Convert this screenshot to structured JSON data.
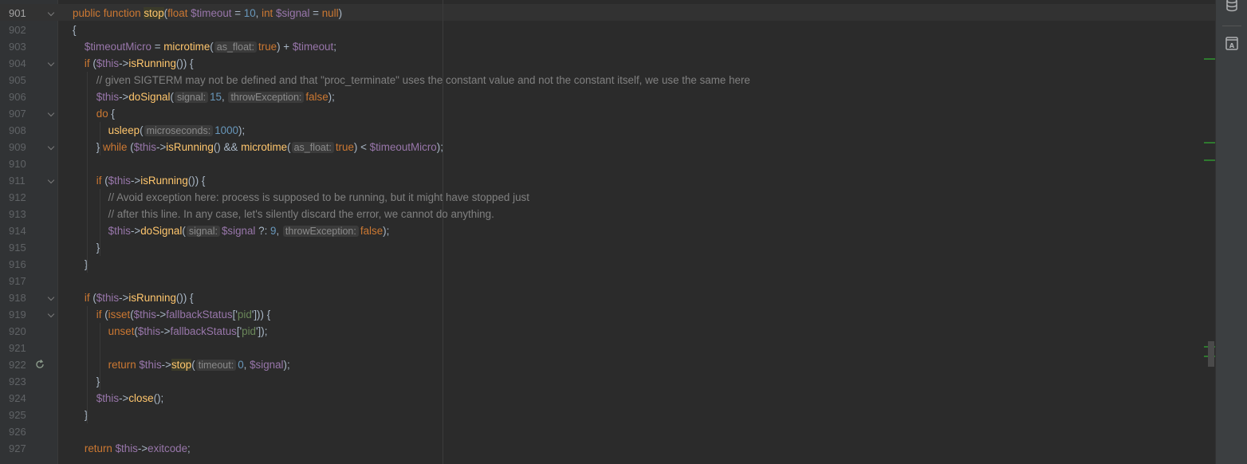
{
  "editor": {
    "lines": [
      {
        "n": "901",
        "fold": true,
        "current": true,
        "segs": [
          [
            "kw",
            "public function "
          ],
          [
            "fn-hl",
            "stop"
          ],
          [
            "plain",
            "("
          ],
          [
            "kw",
            "float "
          ],
          [
            "var",
            "$timeout"
          ],
          [
            "plain",
            " = "
          ],
          [
            "num",
            "10"
          ],
          [
            "plain",
            ", "
          ],
          [
            "kw",
            "int "
          ],
          [
            "var",
            "$signal"
          ],
          [
            "plain",
            " = "
          ],
          [
            "kw",
            "null"
          ],
          [
            "plain",
            ")"
          ]
        ]
      },
      {
        "n": "902",
        "segs": [
          [
            "plain",
            "{"
          ]
        ]
      },
      {
        "n": "903",
        "segs": [
          [
            "plain",
            "    "
          ],
          [
            "var",
            "$timeoutMicro"
          ],
          [
            "plain",
            " = "
          ],
          [
            "fn",
            "microtime"
          ],
          [
            "plain",
            "("
          ],
          [
            "hint",
            "as_float:"
          ],
          [
            "kw",
            "true"
          ],
          [
            "plain",
            ") + "
          ],
          [
            "var",
            "$timeout"
          ],
          [
            "plain",
            ";"
          ]
        ]
      },
      {
        "n": "904",
        "fold": true,
        "segs": [
          [
            "plain",
            "    "
          ],
          [
            "kw",
            "if "
          ],
          [
            "plain",
            "("
          ],
          [
            "var",
            "$this"
          ],
          [
            "plain",
            "->"
          ],
          [
            "fn",
            "isRunning"
          ],
          [
            "plain",
            "()) {"
          ]
        ]
      },
      {
        "n": "905",
        "segs": [
          [
            "plain",
            "        "
          ],
          [
            "cmt",
            "// given SIGTERM may not be defined and that \"proc_terminate\" uses the constant value and not the constant itself, we use the same here"
          ]
        ]
      },
      {
        "n": "906",
        "segs": [
          [
            "plain",
            "        "
          ],
          [
            "var",
            "$this"
          ],
          [
            "plain",
            "->"
          ],
          [
            "fn",
            "doSignal"
          ],
          [
            "plain",
            "("
          ],
          [
            "hint",
            "signal:"
          ],
          [
            "num",
            "15"
          ],
          [
            "plain",
            ", "
          ],
          [
            "hint",
            "throwException:"
          ],
          [
            "kw",
            "false"
          ],
          [
            "plain",
            ");"
          ]
        ]
      },
      {
        "n": "907",
        "fold": true,
        "segs": [
          [
            "plain",
            "        "
          ],
          [
            "kw",
            "do "
          ],
          [
            "plain",
            "{"
          ]
        ]
      },
      {
        "n": "908",
        "segs": [
          [
            "plain",
            "            "
          ],
          [
            "fn",
            "usleep"
          ],
          [
            "plain",
            "("
          ],
          [
            "hint",
            "microseconds:"
          ],
          [
            "num",
            "1000"
          ],
          [
            "plain",
            ");"
          ]
        ]
      },
      {
        "n": "909",
        "fold": true,
        "segs": [
          [
            "plain",
            "        } "
          ],
          [
            "kw",
            "while "
          ],
          [
            "plain",
            "("
          ],
          [
            "var",
            "$this"
          ],
          [
            "plain",
            "->"
          ],
          [
            "fn",
            "isRunning"
          ],
          [
            "plain",
            "() && "
          ],
          [
            "fn",
            "microtime"
          ],
          [
            "plain",
            "("
          ],
          [
            "hint",
            "as_float:"
          ],
          [
            "kw",
            "true"
          ],
          [
            "plain",
            ") < "
          ],
          [
            "var",
            "$timeoutMicro"
          ],
          [
            "plain",
            ");"
          ]
        ]
      },
      {
        "n": "910",
        "segs": []
      },
      {
        "n": "911",
        "fold": true,
        "segs": [
          [
            "plain",
            "        "
          ],
          [
            "kw",
            "if "
          ],
          [
            "plain",
            "("
          ],
          [
            "var",
            "$this"
          ],
          [
            "plain",
            "->"
          ],
          [
            "fn",
            "isRunning"
          ],
          [
            "plain",
            "()) {"
          ]
        ]
      },
      {
        "n": "912",
        "segs": [
          [
            "plain",
            "            "
          ],
          [
            "cmt",
            "// Avoid exception here: process is supposed to be running, but it might have stopped just"
          ]
        ]
      },
      {
        "n": "913",
        "segs": [
          [
            "plain",
            "            "
          ],
          [
            "cmt",
            "// after this line. In any case, let's silently discard the error, we cannot do anything."
          ]
        ]
      },
      {
        "n": "914",
        "segs": [
          [
            "plain",
            "            "
          ],
          [
            "var",
            "$this"
          ],
          [
            "plain",
            "->"
          ],
          [
            "fn",
            "doSignal"
          ],
          [
            "plain",
            "("
          ],
          [
            "hint",
            "signal:"
          ],
          [
            "var",
            "$signal"
          ],
          [
            "plain",
            " ?: "
          ],
          [
            "num",
            "9"
          ],
          [
            "plain",
            ", "
          ],
          [
            "hint",
            "throwException:"
          ],
          [
            "kw",
            "false"
          ],
          [
            "plain",
            ");"
          ]
        ]
      },
      {
        "n": "915",
        "segs": [
          [
            "plain",
            "        }"
          ]
        ]
      },
      {
        "n": "916",
        "segs": [
          [
            "plain",
            "    }"
          ]
        ]
      },
      {
        "n": "917",
        "segs": []
      },
      {
        "n": "918",
        "fold": true,
        "segs": [
          [
            "plain",
            "    "
          ],
          [
            "kw",
            "if "
          ],
          [
            "plain",
            "("
          ],
          [
            "var",
            "$this"
          ],
          [
            "plain",
            "->"
          ],
          [
            "fn",
            "isRunning"
          ],
          [
            "plain",
            "()) {"
          ]
        ]
      },
      {
        "n": "919",
        "fold": true,
        "segs": [
          [
            "plain",
            "        "
          ],
          [
            "kw",
            "if "
          ],
          [
            "plain",
            "("
          ],
          [
            "kw",
            "isset"
          ],
          [
            "plain",
            "("
          ],
          [
            "var",
            "$this"
          ],
          [
            "plain",
            "->"
          ],
          [
            "var",
            "fallbackStatus"
          ],
          [
            "plain",
            "['"
          ],
          [
            "str",
            "pid"
          ],
          [
            "plain",
            "'])) {"
          ]
        ]
      },
      {
        "n": "920",
        "segs": [
          [
            "plain",
            "            "
          ],
          [
            "kw",
            "unset"
          ],
          [
            "plain",
            "("
          ],
          [
            "var",
            "$this"
          ],
          [
            "plain",
            "->"
          ],
          [
            "var",
            "fallbackStatus"
          ],
          [
            "plain",
            "['"
          ],
          [
            "str",
            "pid"
          ],
          [
            "plain",
            "']);"
          ]
        ]
      },
      {
        "n": "921",
        "segs": []
      },
      {
        "n": "922",
        "recursion": true,
        "segs": [
          [
            "plain",
            "            "
          ],
          [
            "kw",
            "return "
          ],
          [
            "var",
            "$this"
          ],
          [
            "plain",
            "->"
          ],
          [
            "fn-hl",
            "stop"
          ],
          [
            "plain",
            "("
          ],
          [
            "hint",
            "timeout:"
          ],
          [
            "num",
            "0"
          ],
          [
            "plain",
            ", "
          ],
          [
            "var",
            "$signal"
          ],
          [
            "plain",
            ");"
          ]
        ]
      },
      {
        "n": "923",
        "segs": [
          [
            "plain",
            "        }"
          ]
        ]
      },
      {
        "n": "924",
        "segs": [
          [
            "plain",
            "        "
          ],
          [
            "var",
            "$this"
          ],
          [
            "plain",
            "->"
          ],
          [
            "fn",
            "close"
          ],
          [
            "plain",
            "();"
          ]
        ]
      },
      {
        "n": "925",
        "segs": [
          [
            "plain",
            "    }"
          ]
        ]
      },
      {
        "n": "926",
        "segs": []
      },
      {
        "n": "927",
        "segs": [
          [
            "plain",
            "    "
          ],
          [
            "kw",
            "return "
          ],
          [
            "var",
            "$this"
          ],
          [
            "plain",
            "->"
          ],
          [
            "var",
            "exitcode"
          ],
          [
            "plain",
            ";"
          ]
        ]
      }
    ]
  },
  "right_panel": {
    "icons": [
      "database-icon",
      "a-book-icon"
    ]
  },
  "colors": {
    "background": "#2b2b2b",
    "keyword": "#cc7832",
    "function": "#ffc66d",
    "variable": "#9876aa",
    "number": "#6897bb",
    "string": "#6a8759",
    "comment": "#808080"
  }
}
